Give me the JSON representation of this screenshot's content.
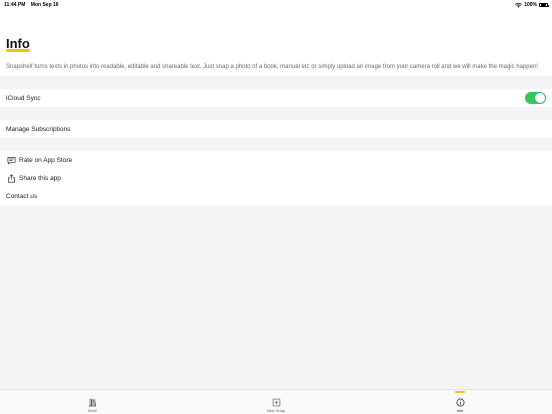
{
  "status_bar": {
    "time": "11:44 PM",
    "date": "Mon Sep 16",
    "battery": "100%",
    "icons": [
      "wifi-icon",
      "battery-icon"
    ]
  },
  "header": {
    "title": "Info",
    "accent_color": "#f2c20c",
    "description": "Snapshelf turns texts in photos into readable, editable and shareable text. Just snap a photo of a book, manual etc or simply upload an image from your camera roll and we will make the magic happen!"
  },
  "settings": {
    "icloud_sync": {
      "label": "iCloud Sync",
      "enabled": true,
      "toggle_color": "#34c759"
    },
    "manage_subscriptions": {
      "label": "Manage Subscriptions"
    },
    "rate": {
      "label": "Rate on App Store",
      "icon": "review-icon"
    },
    "share": {
      "label": "Share this app",
      "icon": "share-icon"
    },
    "contact": {
      "label": "Contact us"
    }
  },
  "tab_bar": {
    "active": "info",
    "tabs": [
      {
        "id": "shelf",
        "label": "Shelf",
        "icon": "shelf-icon"
      },
      {
        "id": "new_snap",
        "label": "New Snap",
        "icon": "new-snap-icon"
      },
      {
        "id": "info",
        "label": "Info",
        "icon": "info-icon"
      }
    ]
  }
}
